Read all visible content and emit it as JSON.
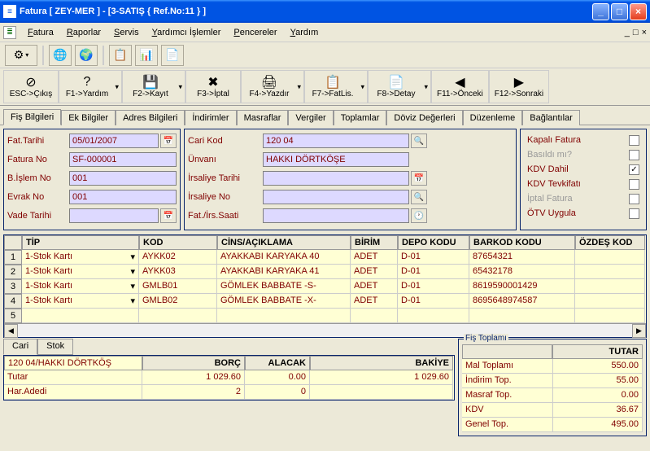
{
  "titlebar": {
    "icon": "≡",
    "text": "Fatura [ ZEY-MER ]  - [3-SATIŞ { Ref.No:11 } ]"
  },
  "menubar": {
    "items": [
      "Fatura",
      "Raporlar",
      "Servis",
      "Yardımcı İşlemler",
      "Pencereler",
      "Yardım"
    ],
    "right": [
      "_",
      "□",
      "×"
    ]
  },
  "toolbar2": [
    {
      "icon": "⊘",
      "label": "ESC->Çıkış",
      "drop": false
    },
    {
      "icon": "?",
      "label": "F1->Yardım",
      "drop": true
    },
    {
      "icon": "💾",
      "label": "F2->Kayıt",
      "drop": true
    },
    {
      "icon": "✖",
      "label": "F3->İptal",
      "drop": false
    },
    {
      "icon": "🖨",
      "label": "F4->Yazdır",
      "drop": true
    },
    {
      "icon": "📋",
      "label": "F7->FatLis.",
      "drop": true
    },
    {
      "icon": "📄",
      "label": "F8->Detay",
      "drop": true
    },
    {
      "icon": "◀",
      "label": "F11->Önceki",
      "drop": false
    },
    {
      "icon": "▶",
      "label": "F12->Sonraki",
      "drop": false
    }
  ],
  "tabs": [
    "Fiş Bilgileri",
    "Ek Bilgiler",
    "Adres Bilgileri",
    "İndirimler",
    "Masraflar",
    "Vergiler",
    "Toplamlar",
    "Döviz Değerleri",
    "Düzenleme",
    "Bağlantılar"
  ],
  "left_fields": [
    {
      "label": "Fat.Tarihi",
      "value": "05/01/2007",
      "btn": "📅"
    },
    {
      "label": "Fatura No",
      "value": "SF-000001",
      "btn": ""
    },
    {
      "label": "B.İşlem No",
      "value": "001",
      "btn": ""
    },
    {
      "label": "Evrak No",
      "value": "001",
      "btn": ""
    },
    {
      "label": "Vade Tarihi",
      "value": "",
      "btn": "📅"
    }
  ],
  "mid_fields": [
    {
      "label": "Cari Kod",
      "value": "120 04",
      "btn": "🔍"
    },
    {
      "label": "Ünvanı",
      "value": "HAKKI DÖRTKÖŞE",
      "btn": ""
    },
    {
      "label": "İrsaliye Tarihi",
      "value": "",
      "btn": "📅"
    },
    {
      "label": "İrsaliye No",
      "value": "",
      "btn": "🔍"
    },
    {
      "label": "Fat./İrs.Saati",
      "value": "",
      "btn": "🕐"
    }
  ],
  "right_checks": [
    {
      "label": "Kapalı Fatura",
      "checked": false,
      "disabled": false
    },
    {
      "label": "Basıldı mı?",
      "checked": false,
      "disabled": true
    },
    {
      "label": "KDV Dahil",
      "checked": true,
      "disabled": false
    },
    {
      "label": "KDV Tevkifatı",
      "checked": false,
      "disabled": false
    },
    {
      "label": "İptal Fatura",
      "checked": false,
      "disabled": true
    },
    {
      "label": "ÖTV Uygula",
      "checked": false,
      "disabled": false
    }
  ],
  "grid": {
    "headers": [
      "",
      "TİP",
      "KOD",
      "CİNS/AÇIKLAMA",
      "BİRİM",
      "DEPO KODU",
      "BARKOD KODU",
      "ÖZDEŞ KOD"
    ],
    "rows": [
      [
        "1",
        "1-Stok Kartı",
        "AYKK02",
        "AYAKKABI KARYAKA 40",
        "ADET",
        "D-01",
        "87654321",
        ""
      ],
      [
        "2",
        "1-Stok Kartı",
        "AYKK03",
        "AYAKKABI KARYAKA 41",
        "ADET",
        "D-01",
        "65432178",
        ""
      ],
      [
        "3",
        "1-Stok Kartı",
        "GMLB01",
        "GÖMLEK BABBATE -S-",
        "ADET",
        "D-01",
        "8619590001429",
        ""
      ],
      [
        "4",
        "1-Stok Kartı",
        "GMLB02",
        "GÖMLEK BABBATE  -X-",
        "ADET",
        "D-01",
        "8695648974587",
        ""
      ],
      [
        "5",
        "",
        "",
        "",
        "",
        "",
        "",
        ""
      ]
    ]
  },
  "subtabs": [
    "Cari",
    "Stok"
  ],
  "cari_grid": {
    "headers": [
      "120 04/HAKKI DÖRTKÖŞ",
      "BORÇ",
      "ALACAK",
      "BAKİYE"
    ],
    "rows": [
      [
        "Tutar",
        "1 029.60",
        "0.00",
        "1 029.60"
      ],
      [
        "Har.Adedi",
        "2",
        "0",
        ""
      ]
    ]
  },
  "totals": {
    "title": "Fiş Toplamı",
    "header": "TUTAR",
    "rows": [
      [
        "Mal Toplamı",
        "550.00"
      ],
      [
        "İndirim Top.",
        "55.00"
      ],
      [
        "Masraf Top.",
        "0.00"
      ],
      [
        "KDV",
        "36.67"
      ],
      [
        "Genel Top.",
        "495.00"
      ]
    ]
  }
}
